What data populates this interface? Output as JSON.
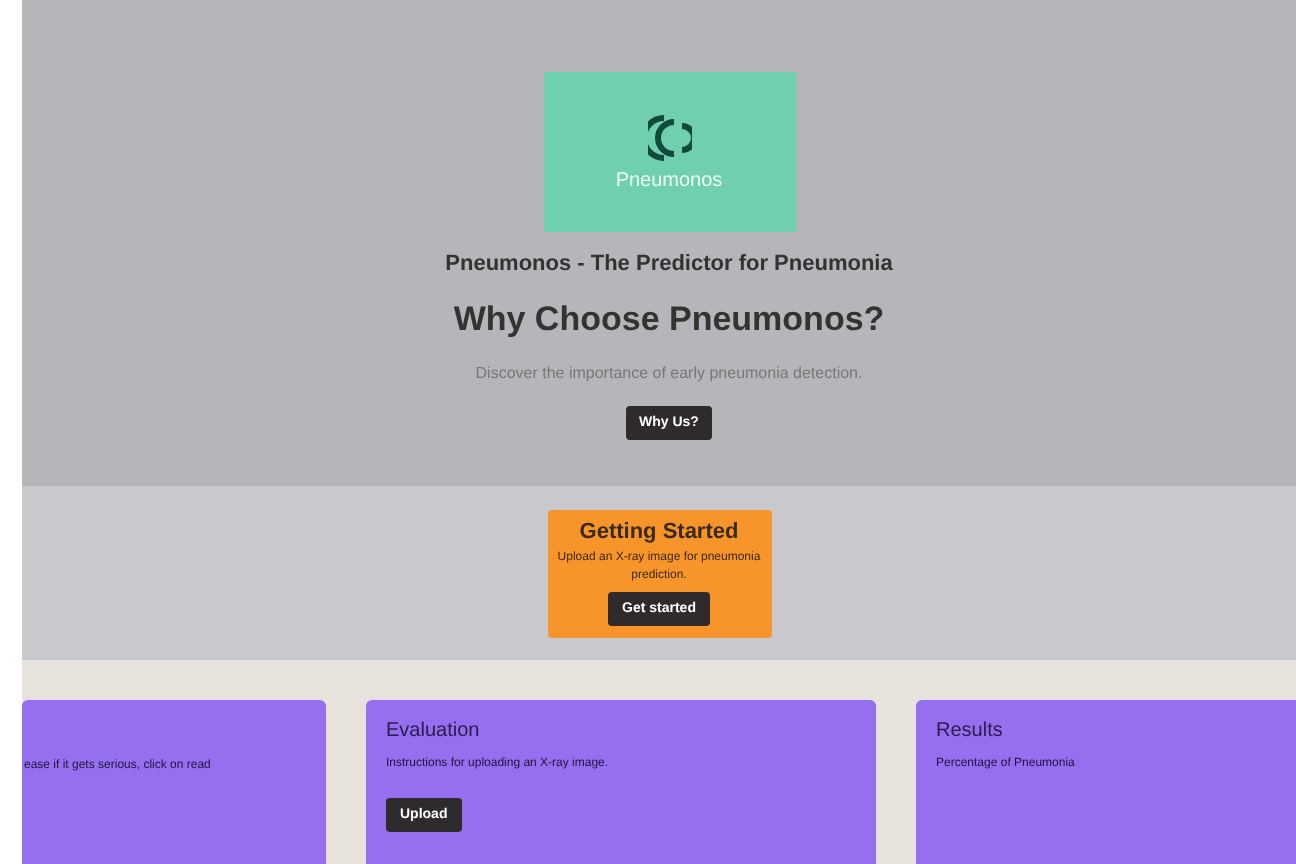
{
  "hero": {
    "logo_text": "Pneumonos",
    "tagline": "Pneumonos - The Predictor for Pneumonia",
    "heading": "Why Choose Pneumonos?",
    "subtext": "Discover the importance of early pneumonia detection.",
    "button": "Why Us?"
  },
  "getting_started": {
    "title": "Getting Started",
    "text": "Upload an X-ray image for pneumonia prediction.",
    "button": "Get started"
  },
  "cards": [
    {
      "text": "ease if it gets serious, click on read"
    },
    {
      "title": "Evaluation",
      "text": "Instructions for uploading an X-ray image.",
      "button": "Upload"
    },
    {
      "title": "Results",
      "text": "Percentage of Pneumonia"
    }
  ]
}
